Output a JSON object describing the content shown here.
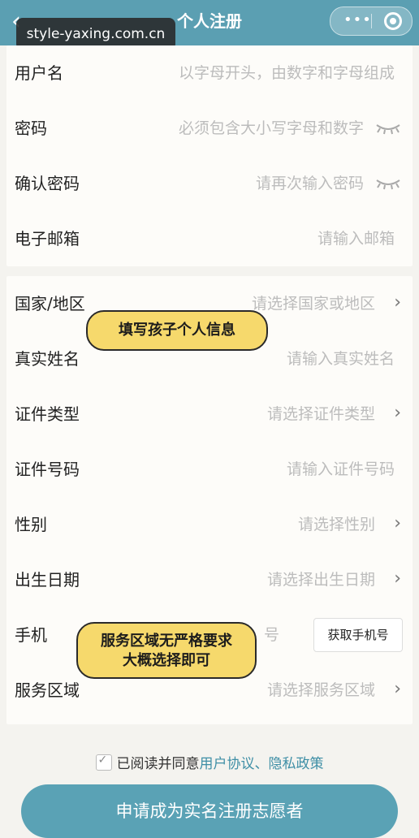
{
  "header": {
    "title": "个人注册",
    "back_icon": "chevron-left-icon",
    "watermark": "style-yaxing.com.cn",
    "capsule": {
      "more": "•••",
      "more_icon": "more-icon",
      "close_icon": "target-icon"
    }
  },
  "account": {
    "username": {
      "label": "用户名",
      "placeholder": "以字母开头，由数字和字母组成"
    },
    "password": {
      "label": "密码",
      "placeholder": "必须包含大小写字母和数字",
      "icon": "eye-closed-icon"
    },
    "confirm": {
      "label": "确认密码",
      "placeholder": "请再次输入密码",
      "icon": "eye-closed-icon"
    },
    "email": {
      "label": "电子邮箱",
      "placeholder": "请输入邮箱"
    }
  },
  "personal": {
    "country": {
      "label": "国家/地区",
      "placeholder": "请选择国家或地区"
    },
    "realname": {
      "label": "真实姓名",
      "placeholder": "请输入真实姓名"
    },
    "idtype": {
      "label": "证件类型",
      "placeholder": "请选择证件类型"
    },
    "idnumber": {
      "label": "证件号码",
      "placeholder": "请输入证件号码"
    },
    "gender": {
      "label": "性别",
      "placeholder": "请选择性别"
    },
    "birthday": {
      "label": "出生日期",
      "placeholder": "请选择出生日期"
    },
    "phone": {
      "label": "手机",
      "placeholder": "号",
      "button": "获取手机号"
    },
    "region": {
      "label": "服务区域",
      "placeholder": "请选择服务区域"
    }
  },
  "annotations": {
    "bubble1": "填写孩子个人信息",
    "bubble2_line1": "服务区域无严格要求",
    "bubble2_line2": "大概选择即可"
  },
  "agreement": {
    "text": "已阅读并同意",
    "links": "用户协议、隐私政策"
  },
  "submit_label": "申请成为实名注册志愿者",
  "colors": {
    "header": "#5b9fb2",
    "button": "#5aa2b5",
    "bubble": "#f6d96c",
    "link": "#3f8fa6"
  }
}
